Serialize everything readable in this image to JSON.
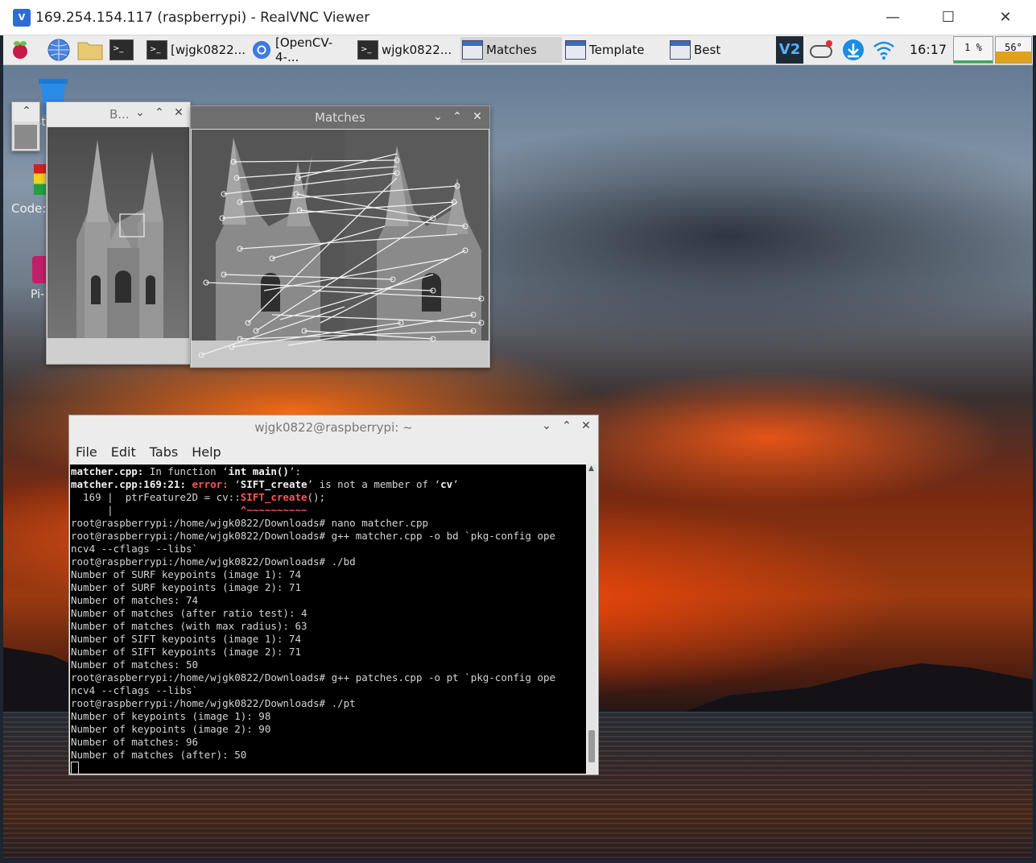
{
  "viewer": {
    "title": "169.254.154.117 (raspberrypi) - RealVNC Viewer",
    "minimize": "—",
    "maximize": "☐",
    "close": "✕"
  },
  "taskbar": {
    "items": [
      {
        "label": "[wjgk0822...",
        "icon": "terminal-icon"
      },
      {
        "label": "[OpenCV-4-...",
        "icon": "chromium-icon"
      },
      {
        "label": "wjgk0822...",
        "icon": "terminal-icon"
      },
      {
        "label": "Matches",
        "icon": "window-icon"
      },
      {
        "label": "Template",
        "icon": "window-icon"
      },
      {
        "label": "Best",
        "icon": "window-icon"
      }
    ],
    "clock": "16:17",
    "cpu": "1 %",
    "temp": "56°"
  },
  "desktop_icons": [
    {
      "label": "st"
    },
    {
      "label": "Code:"
    },
    {
      "label": "Pi-"
    }
  ],
  "best_window": {
    "title": "B..."
  },
  "matches_window": {
    "title": "Matches"
  },
  "terminal": {
    "title": "wjgk0822@raspberrypi: ~",
    "menu": [
      "File",
      "Edit",
      "Tabs",
      "Help"
    ],
    "lines": [
      [
        {
          "t": "matcher.cpp:",
          "c": "b"
        },
        {
          "t": " In function ‘"
        },
        {
          "t": "int main()",
          "c": "b"
        },
        {
          "t": "’:"
        }
      ],
      [
        {
          "t": "matcher.cpp:169:21:",
          "c": "b"
        },
        {
          "t": " "
        },
        {
          "t": "error:",
          "c": "r"
        },
        {
          "t": " ‘"
        },
        {
          "t": "SIFT_create",
          "c": "b"
        },
        {
          "t": "’ is not a member of ‘"
        },
        {
          "t": "cv",
          "c": "b"
        },
        {
          "t": "’"
        }
      ],
      [
        {
          "t": "  169 |  ptrFeature2D = cv::"
        },
        {
          "t": "SIFT_create",
          "c": "r"
        },
        {
          "t": "();"
        }
      ],
      [
        {
          "t": "      |                     "
        },
        {
          "t": "^~~~~~~~~~~",
          "c": "r"
        }
      ],
      [
        {
          "t": "root@raspberrypi:/home/wjgk0822/Downloads# nano matcher.cpp"
        }
      ],
      [
        {
          "t": "root@raspberrypi:/home/wjgk0822/Downloads# g++ matcher.cpp -o bd `pkg-config ope"
        }
      ],
      [
        {
          "t": "ncv4 --cflags --libs`"
        }
      ],
      [
        {
          "t": "root@raspberrypi:/home/wjgk0822/Downloads# ./bd"
        }
      ],
      [
        {
          "t": "Number of SURF keypoints (image 1): 74"
        }
      ],
      [
        {
          "t": "Number of SURF keypoints (image 2): 71"
        }
      ],
      [
        {
          "t": "Number of matches: 74"
        }
      ],
      [
        {
          "t": "Number of matches (after ratio test): 4"
        }
      ],
      [
        {
          "t": "Number of matches (with max radius): 63"
        }
      ],
      [
        {
          "t": "Number of SIFT keypoints (image 1): 74"
        }
      ],
      [
        {
          "t": "Number of SIFT keypoints (image 2): 71"
        }
      ],
      [
        {
          "t": "Number of matches: 50"
        }
      ],
      [
        {
          "t": "root@raspberrypi:/home/wjgk0822/Downloads# g++ patches.cpp -o pt `pkg-config ope"
        }
      ],
      [
        {
          "t": "ncv4 --cflags --libs`"
        }
      ],
      [
        {
          "t": "root@raspberrypi:/home/wjgk0822/Downloads# ./pt"
        }
      ],
      [
        {
          "t": "Number of keypoints (image 1): 98"
        }
      ],
      [
        {
          "t": "Number of keypoints (image 2): 90"
        }
      ],
      [
        {
          "t": "Number of matches: 96"
        }
      ],
      [
        {
          "t": "Number of matches (after): 50"
        }
      ]
    ]
  }
}
